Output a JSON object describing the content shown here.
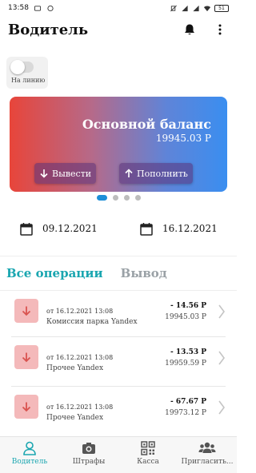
{
  "status_bar": {
    "time": "13:58",
    "battery": "51",
    "colors": {
      "text": "#111111"
    }
  },
  "header": {
    "title": "Водитель",
    "bell_icon": "bell-icon",
    "menu_icon": "more-vertical-icon"
  },
  "online": {
    "label": "На линию",
    "enabled": false
  },
  "balance_card": {
    "title": "Основной баланс",
    "amount": "19945.03 Р",
    "withdraw_label": "Вывести",
    "topup_label": "Пополнить",
    "gradient": [
      "#e8453a",
      "#3a8ef0"
    ]
  },
  "carousel": {
    "page_count": 4,
    "active_index": 0
  },
  "dates": {
    "from": "09.12.2021",
    "to": "16.12.2021",
    "icon": "calendar-icon"
  },
  "tabs": [
    {
      "label": "Все операции",
      "active": true
    },
    {
      "label": "Вывод",
      "active": false
    }
  ],
  "operations": [
    {
      "date": "от 16.12.2021 13:08",
      "description": "Комиссия парка Yandex",
      "amount": "- 14.56 Р",
      "balance": "19945.03 Р"
    },
    {
      "date": "от 16.12.2021 13:08",
      "description": "Прочее Yandex",
      "amount": "- 13.53 Р",
      "balance": "19959.59 Р"
    },
    {
      "date": "от 16.12.2021 13:08",
      "description": "Прочее Yandex",
      "amount": "- 67.67 Р",
      "balance": "19973.12 Р"
    }
  ],
  "bottom_nav": [
    {
      "label": "Водитель",
      "icon": "person-icon",
      "active": true
    },
    {
      "label": "Штрафы",
      "icon": "camera-icon",
      "active": false
    },
    {
      "label": "Касса",
      "icon": "qr-code-icon",
      "active": false
    },
    {
      "label": "Пригласить...",
      "icon": "group-icon",
      "active": false
    }
  ],
  "colors": {
    "accent": "#1aa6b0",
    "carousel_active": "#1d8fd8",
    "debit_icon_bg": "#f4b9ba",
    "debit_arrow": "#d9534f"
  }
}
